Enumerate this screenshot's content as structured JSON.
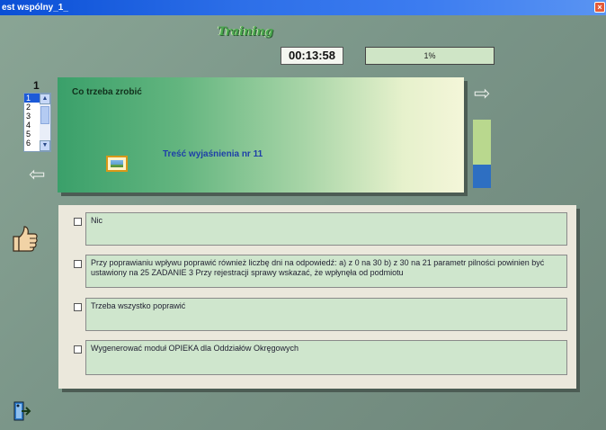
{
  "window": {
    "title": "est wspólny_1_"
  },
  "header": {
    "mode": "Training",
    "timer": "00:13:58",
    "progress_label": "1%",
    "progress_fraction": 0.01
  },
  "question_nav": {
    "current": "1",
    "items": [
      "1",
      "2",
      "3",
      "4",
      "5",
      "6"
    ],
    "selected": "1"
  },
  "question": {
    "text": "Co trzeba zrobić",
    "explanation": "Treść wyjaśnienia nr 11"
  },
  "answers": [
    {
      "text": "Nic"
    },
    {
      "text": "Przy poprawianiu wpływu poprawić również liczbę dni na odpowiedź: a) z 0 na 30 b) z 30 na 21 parametr pilności powinien być ustawiony na 25 ZADANIE 3 Przy rejestracji sprawy wskazać, że wpłynęła od podmiotu"
    },
    {
      "text": "Trzeba wszystko poprawić"
    },
    {
      "text": "Wygenerować moduł OPIEKA dla Oddziałów Okręgowych"
    }
  ],
  "colors": {
    "background": "#7a9588",
    "titlebar": "#2d6fe8",
    "accent_blue": "#2e6fc2",
    "accent_green": "#b9d88e"
  },
  "icons": [
    "close-icon",
    "left-arrow-icon",
    "right-arrow-icon",
    "image-icon",
    "thumbs-up-icon",
    "exit-door-icon"
  ]
}
